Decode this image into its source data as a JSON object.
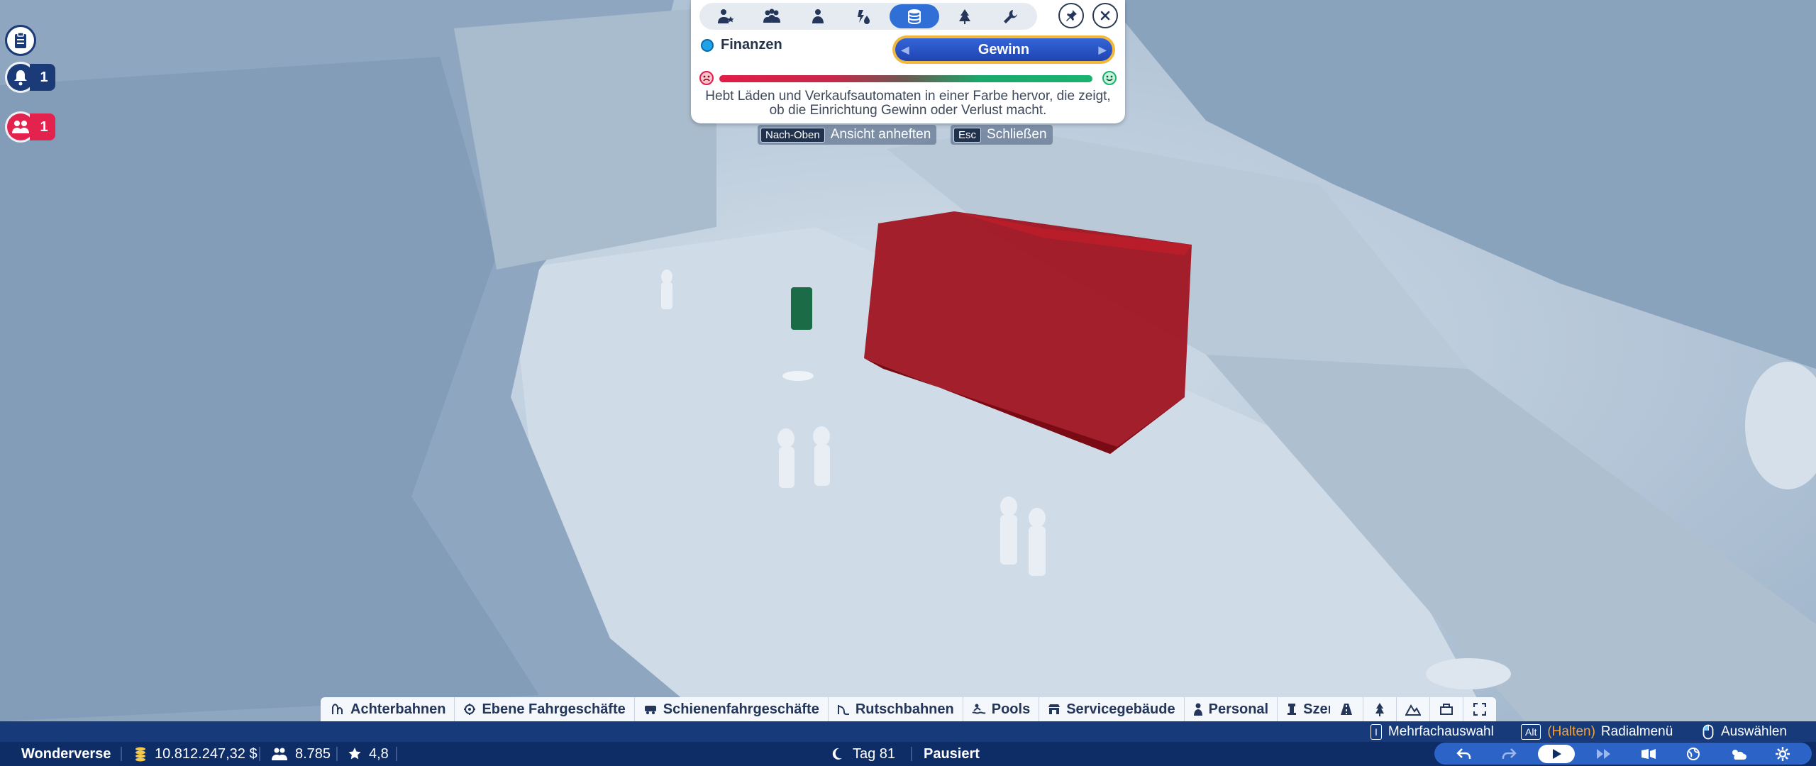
{
  "left_panel": {
    "notifications_count": "1",
    "guests_count": "1"
  },
  "overlay": {
    "mode_label": "Finanzen",
    "dropdown_value": "Gewinn",
    "description_line1": "Hebt Läden und Verkaufsautomaten in einer Farbe hervor, die zeigt,",
    "description_line2": "ob die Einrichtung Gewinn oder Verlust macht.",
    "tabs": [
      "guest-rating-icon",
      "guests-icon",
      "guest-icon",
      "thoughts-icon",
      "finance-icon",
      "scenery-icon",
      "wrench-icon"
    ],
    "active_tab": "finance-icon",
    "scale_colors": {
      "negative": "#e11d48",
      "positive": "#19b36f"
    }
  },
  "key_hints": {
    "pin_key": "Nach-Oben",
    "pin_label": "Ansicht anheften",
    "close_key": "Esc",
    "close_label": "Schließen"
  },
  "categories": [
    {
      "icon": "coaster-icon",
      "label": "Achterbahnen"
    },
    {
      "icon": "flat-ride-icon",
      "label": "Ebene Fahrgeschäfte"
    },
    {
      "icon": "track-ride-icon",
      "label": "Schienenfahrgeschäfte"
    },
    {
      "icon": "slide-icon",
      "label": "Rutschbahnen"
    },
    {
      "icon": "pool-icon",
      "label": "Pools"
    },
    {
      "icon": "shop-icon",
      "label": "Servicegebäude"
    },
    {
      "icon": "staff-icon",
      "label": "Personal"
    },
    {
      "icon": "scenery-icon",
      "label": "Szenerie"
    }
  ],
  "bottom_hints": {
    "multi_key": "I",
    "multi_label": "Mehrfachauswahl",
    "alt_key": "Alt",
    "hold_label": "(Halten)",
    "radial_label": "Radialmenü",
    "select_label": "Auswählen"
  },
  "status": {
    "park_name": "Wonderverse",
    "money": "10.812.247,32 $",
    "guests": "8.785",
    "rating": "4,8",
    "day": "Tag 81",
    "state": "Pausiert"
  },
  "colors": {
    "accent": "#2f6fd6",
    "status_bar": "#0e2c66",
    "hint_bar": "#173a7a",
    "highlight_loss": "#a10f1c",
    "focus_ring": "#f2b83b"
  }
}
